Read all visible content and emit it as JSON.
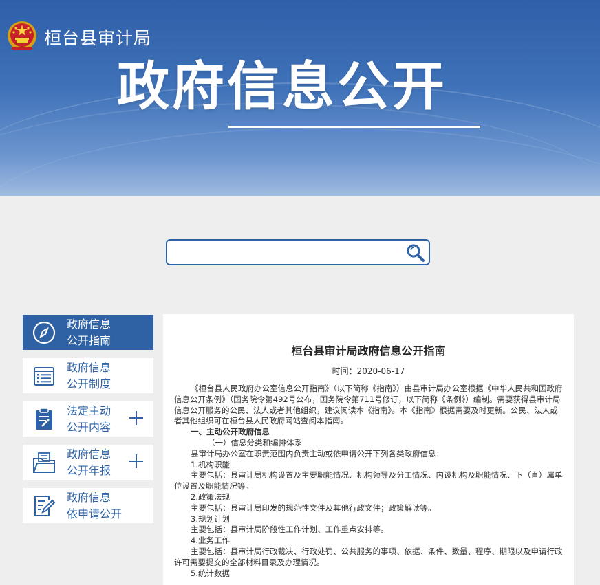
{
  "header": {
    "site_name": "桓台县审计局",
    "page_heading": "政府信息公开"
  },
  "search": {
    "placeholder": ""
  },
  "sidebar": {
    "items": [
      {
        "line1": "政府信息",
        "line2": "公开指南",
        "icon": "compass-icon",
        "active": true,
        "expandable": false
      },
      {
        "line1": "政府信息",
        "line2": "公开制度",
        "icon": "list-icon",
        "active": false,
        "expandable": false
      },
      {
        "line1": "法定主动",
        "line2": "公开内容",
        "icon": "clipboard-icon",
        "active": false,
        "expandable": true
      },
      {
        "line1": "政府信息",
        "line2": "公开年报",
        "icon": "folder-icon",
        "active": false,
        "expandable": true
      },
      {
        "line1": "政府信息",
        "line2": "依申请公开",
        "icon": "edit-document-icon",
        "active": false,
        "expandable": false
      }
    ]
  },
  "document": {
    "title": "桓台县审计局政府信息公开指南",
    "time": "时间：2020-06-17",
    "paragraphs": [
      "《桓台县人民政府办公室信息公开指南》（以下简称《指南》）由县审计局办公室根据《中华人民共和国政府信息公开条例》（国务院令第492号公布，国务院令第711号修订，以下简称《条例》）编制。需要获得县审计局信息公开服务的公民、法人或者其他组织，建议阅读本《指南》。本《指南》根据需要及时更新。公民、法人或者其他组织可在桓台县人民政府网站查阅本指南。",
      "一、主动公开政府信息",
      "（一）信息分类和编排体系",
      "县审计局办公室在职责范围内负责主动或依申请公开下列各类政府信息：",
      "1.机构职能",
      "主要包括：县审计局机构设置及主要职能情况、机构领导及分工情况、内设机构及职能情况、下（直）属单位设置及职能情况等。",
      "2.政策法规",
      "主要包括：县审计局印发的规范性文件及其他行政文件；政策解读等。",
      "3.规划计划",
      "主要包括：县审计局阶段性工作计划、工作重点安排等。",
      "4.业务工作",
      "主要包括：县审计局行政裁决、行政处罚、公共服务的事项、依据、条件、数量、程序、期限以及申请行政许可需要提交的全部材料目录及办理情况。",
      "5.统计数据"
    ]
  },
  "colors": {
    "primary": "#2e62a5",
    "page_bg": "#eeeeee"
  }
}
